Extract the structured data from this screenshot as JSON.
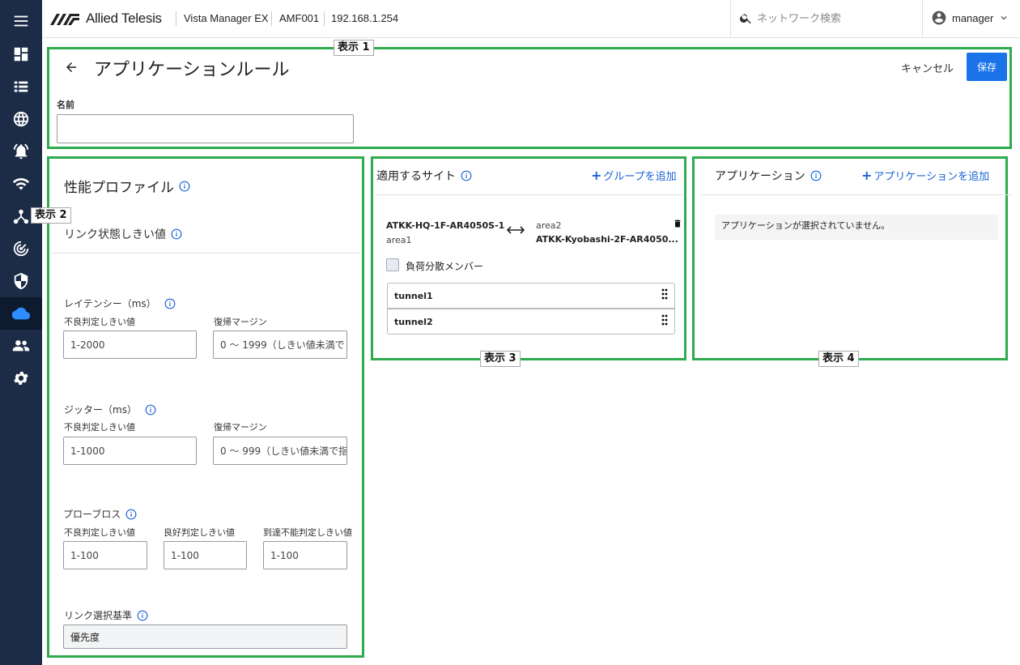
{
  "header": {
    "brand": "Allied Telesis",
    "product": "Vista Manager EX",
    "device": "AMF001",
    "ip": "192.168.1.254",
    "search_placeholder": "ネットワーク検索",
    "user": "manager"
  },
  "sidebar": {
    "items": [
      {
        "icon": "menu-icon"
      },
      {
        "icon": "dashboard-icon"
      },
      {
        "icon": "list-icon"
      },
      {
        "icon": "globe-icon"
      },
      {
        "icon": "alarm-icon"
      },
      {
        "icon": "wifi-icon"
      },
      {
        "icon": "topology-icon"
      },
      {
        "icon": "radar-icon"
      },
      {
        "icon": "shield-icon"
      },
      {
        "icon": "cloud-icon",
        "active": true
      },
      {
        "icon": "users-icon"
      },
      {
        "icon": "gear-icon"
      }
    ]
  },
  "annotations": {
    "tag1": "表示 1",
    "tag2": "表示 2",
    "tag3": "表示 3",
    "tag4": "表示 4",
    "color": "#2fab4f"
  },
  "page": {
    "title": "アプリケーションルール",
    "cancel_label": "キャンセル",
    "save_label": "保存",
    "name_label": "名前",
    "name_value": ""
  },
  "profile": {
    "title": "性能プロファイル",
    "link_threshold_title": "リンク状態しきい値",
    "latency": {
      "title": "レイテンシー（ms）",
      "bad_label": "不良判定しきい値",
      "bad_placeholder": "1-2000",
      "recover_label": "復帰マージン",
      "recover_placeholder": "0 ～ 1999（しきい値未満で"
    },
    "jitter": {
      "title": "ジッター（ms）",
      "bad_label": "不良判定しきい値",
      "bad_placeholder": "1-1000",
      "recover_label": "復帰マージン",
      "recover_placeholder": "0 ～ 999（しきい値未満で指"
    },
    "probe_loss": {
      "title": "プローブロス",
      "bad_label": "不良判定しきい値",
      "bad_placeholder": "1-100",
      "good_label": "良好判定しきい値",
      "good_placeholder": "1-100",
      "unreach_label": "到達不能判定しきい値",
      "unreach_placeholder": "1-100"
    },
    "link_select": {
      "title": "リンク選択基準",
      "value": "優先度"
    }
  },
  "sites": {
    "title": "適用するサイト",
    "add_group_label": "グループを追加",
    "site_a_name": "ATKK-HQ-1F-AR4050S-1",
    "site_a_area": "area1",
    "site_b_area": "area2",
    "site_b_name": "ATKK-Kyobashi-2F-AR4050...",
    "load_balance_label": "負荷分散メンバー",
    "tunnels": [
      "tunnel1",
      "tunnel2"
    ]
  },
  "apps": {
    "title": "アプリケーション",
    "add_label": "アプリケーションを追加",
    "empty_message": "アプリケーションが選択されていません。"
  }
}
